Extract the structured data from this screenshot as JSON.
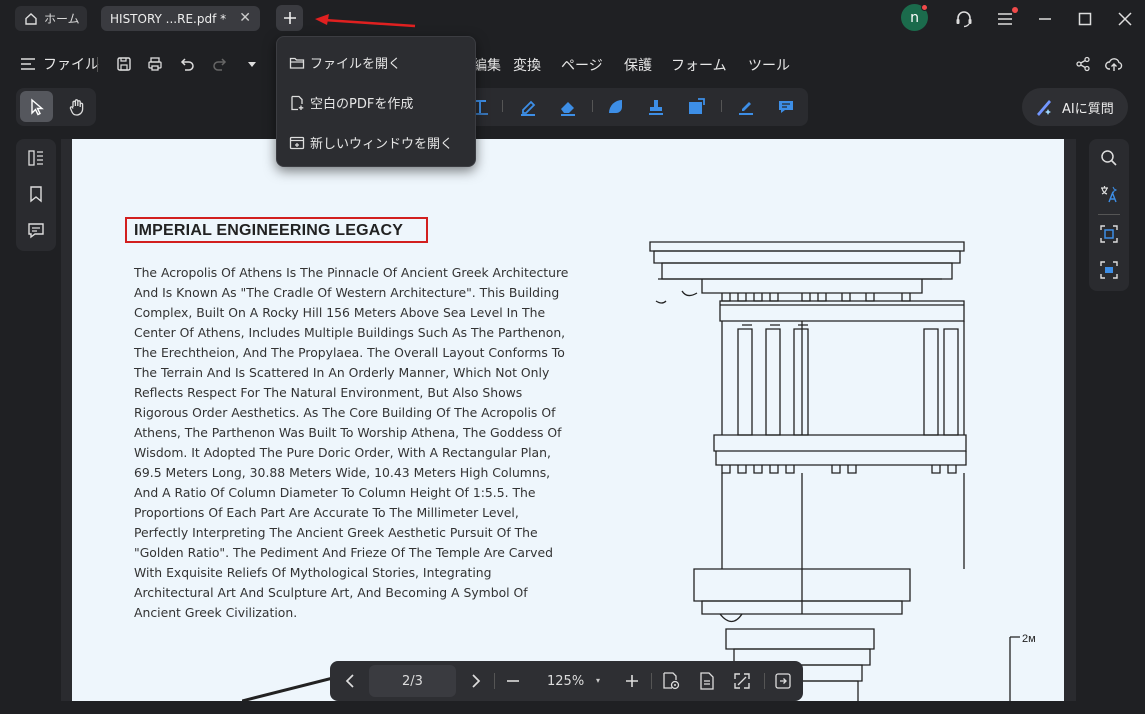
{
  "tabs": {
    "home_label": "ホーム",
    "doc_label": "HISTORY ...RE.pdf *",
    "close_glyph": "✕",
    "new_tab_glyph": "+"
  },
  "user": {
    "avatar_letter": "n"
  },
  "menubar": {
    "file_label": "ファイル",
    "items": [
      "編集",
      "変換",
      "ページ",
      "保護",
      "フォーム",
      "ツール"
    ]
  },
  "ai_button": {
    "label": "AIに質問"
  },
  "dropdown": {
    "items": [
      "ファイルを開く",
      "空白のPDFを作成",
      "新しいウィンドウを開く"
    ]
  },
  "document": {
    "heading": "IMPERIAL ENGINEERING LEGACY",
    "body": "The Acropolis Of Athens Is The Pinnacle Of Ancient Greek Architecture And Is Known As \"The Cradle Of Western Architecture\". This Building Complex, Built On A Rocky Hill 156 Meters Above Sea Level In The Center Of Athens, Includes Multiple Buildings Such As The Parthenon, The Erechtheion, And The Propylaea. The Overall Layout Conforms To The Terrain And Is Scattered In An Orderly Manner, Which Not Only Reflects Respect For The Natural Environment, But Also Shows Rigorous Order Aesthetics. As The Core Building Of The Acropolis Of Athens, The Parthenon Was Built To Worship Athena, The Goddess Of Wisdom. It Adopted The Pure Doric Order, With A Rectangular Plan, 69.5 Meters Long, 30.88 Meters Wide, 10.43 Meters High Columns, And A Ratio Of Column Diameter To Column Height Of 1:5.5. The Proportions Of Each Part Are Accurate To The Millimeter Level, Perfectly Interpreting The Ancient Greek Aesthetic Pursuit Of The \"Golden Ratio\". The Pediment And Frieze Of The Temple Are Carved With Exquisite Reliefs Of Mythological Stories, Integrating Architectural Art And Sculpture Art, And Becoming A Symbol Of Ancient Greek Civilization.",
    "drawing_label": "2м"
  },
  "navigation": {
    "page_indicator": "2/3",
    "zoom": "125%",
    "zoom_caret": "▾",
    "plus_glyph": "+",
    "minus_glyph": "—"
  },
  "colors": {
    "accent_red": "#d21f1f",
    "avatar_green": "#1b6b4c",
    "notification_red": "#f04a4a",
    "tool_blue": "#3d8ee6"
  }
}
